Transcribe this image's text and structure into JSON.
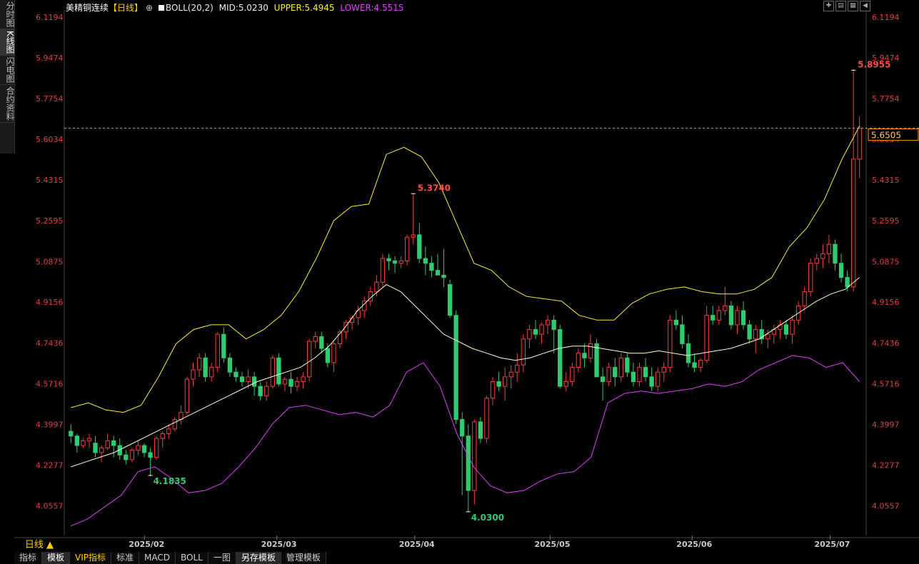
{
  "sidebar": {
    "tabs": [
      "分时图",
      "K线图",
      "闪电图",
      "合约资料"
    ]
  },
  "header": {
    "title": "美精铜连续",
    "period_tag": "【日线】",
    "ind_name": "BOLL(20,2)",
    "mid": "MID:5.0230",
    "upper": "UPPER:5.4945",
    "lower": "LOWER:4.5515"
  },
  "period_label": "日线 ▲",
  "bottom_tabs": [
    "指标",
    "模板",
    "VIP指标",
    "标准",
    "MACD",
    "BOLL",
    "一图",
    "另存模板",
    "管理模板"
  ],
  "chart_data": {
    "type": "candlestick",
    "y_ticks": [
      "6.1194",
      "5.9474",
      "5.7754",
      "5.6034",
      "5.4315",
      "5.2595",
      "5.0875",
      "4.9156",
      "4.7436",
      "4.5716",
      "4.3997",
      "4.2277",
      "4.0557"
    ],
    "x_ticks": [
      "2025/02",
      "2025/03",
      "2025/04",
      "2025/05",
      "2025/06",
      "2025/07"
    ],
    "ylim": [
      3.93,
      6.15
    ],
    "current_price": "5.6505",
    "annotations": {
      "high": "5.3740",
      "low": "4.1835",
      "low2": "4.0300",
      "max": "5.8955"
    },
    "colors": {
      "up": "#ff3b3b",
      "down": "#2ecc71",
      "mid": "#ffffcc",
      "upper": "#ffee33",
      "lower": "#e040fb",
      "price": "#ff9900"
    },
    "candles": [
      [
        4.37,
        4.4,
        4.32,
        4.35
      ],
      [
        4.35,
        4.36,
        4.28,
        4.31
      ],
      [
        4.31,
        4.34,
        4.3,
        4.33
      ],
      [
        4.33,
        4.36,
        4.3,
        4.34
      ],
      [
        4.32,
        4.35,
        4.26,
        4.28
      ],
      [
        4.28,
        4.31,
        4.24,
        4.3
      ],
      [
        4.3,
        4.36,
        4.29,
        4.33
      ],
      [
        4.33,
        4.35,
        4.26,
        4.31
      ],
      [
        4.31,
        4.34,
        4.25,
        4.27
      ],
      [
        4.27,
        4.29,
        4.23,
        4.25
      ],
      [
        4.25,
        4.3,
        4.24,
        4.29
      ],
      [
        4.29,
        4.33,
        4.27,
        4.31
      ],
      [
        4.31,
        4.32,
        4.26,
        4.28
      ],
      [
        4.28,
        4.3,
        4.18,
        4.26
      ],
      [
        4.26,
        4.35,
        4.25,
        4.34
      ],
      [
        4.34,
        4.37,
        4.3,
        4.36
      ],
      [
        4.36,
        4.4,
        4.34,
        4.38
      ],
      [
        4.38,
        4.43,
        4.37,
        4.42
      ],
      [
        4.42,
        4.48,
        4.4,
        4.45
      ],
      [
        4.45,
        4.6,
        4.44,
        4.59
      ],
      [
        4.59,
        4.66,
        4.56,
        4.63
      ],
      [
        4.63,
        4.7,
        4.6,
        4.68
      ],
      [
        4.68,
        4.7,
        4.58,
        4.6
      ],
      [
        4.6,
        4.66,
        4.58,
        4.64
      ],
      [
        4.64,
        4.79,
        4.62,
        4.78
      ],
      [
        4.78,
        4.81,
        4.66,
        4.68
      ],
      [
        4.68,
        4.7,
        4.6,
        4.62
      ],
      [
        4.62,
        4.64,
        4.58,
        4.6
      ],
      [
        4.6,
        4.62,
        4.56,
        4.58
      ],
      [
        4.58,
        4.63,
        4.55,
        4.6
      ],
      [
        4.6,
        4.62,
        4.52,
        4.56
      ],
      [
        4.56,
        4.58,
        4.5,
        4.52
      ],
      [
        4.52,
        4.58,
        4.5,
        4.56
      ],
      [
        4.56,
        4.69,
        4.55,
        4.68
      ],
      [
        4.68,
        4.7,
        4.56,
        4.57
      ],
      [
        4.57,
        4.6,
        4.54,
        4.59
      ],
      [
        4.59,
        4.62,
        4.53,
        4.56
      ],
      [
        4.56,
        4.6,
        4.54,
        4.58
      ],
      [
        4.58,
        4.62,
        4.55,
        4.6
      ],
      [
        4.6,
        4.76,
        4.58,
        4.75
      ],
      [
        4.75,
        4.79,
        4.72,
        4.77
      ],
      [
        4.77,
        4.79,
        4.7,
        4.72
      ],
      [
        4.72,
        4.74,
        4.64,
        4.66
      ],
      [
        4.66,
        4.75,
        4.62,
        4.74
      ],
      [
        4.74,
        4.8,
        4.72,
        4.79
      ],
      [
        4.79,
        4.84,
        4.76,
        4.83
      ],
      [
        4.83,
        4.86,
        4.8,
        4.85
      ],
      [
        4.85,
        4.9,
        4.82,
        4.88
      ],
      [
        4.88,
        4.94,
        4.85,
        4.92
      ],
      [
        4.92,
        4.98,
        4.9,
        4.96
      ],
      [
        4.96,
        5.03,
        4.94,
        5.0
      ],
      [
        5.0,
        5.12,
        4.98,
        5.1
      ],
      [
        5.1,
        5.12,
        5.05,
        5.09
      ],
      [
        5.09,
        5.11,
        5.04,
        5.08
      ],
      [
        5.08,
        5.11,
        5.06,
        5.09
      ],
      [
        5.09,
        5.2,
        5.07,
        5.19
      ],
      [
        5.19,
        5.37,
        5.16,
        5.2
      ],
      [
        5.2,
        5.25,
        5.08,
        5.1
      ],
      [
        5.1,
        5.15,
        5.03,
        5.08
      ],
      [
        5.08,
        5.11,
        5.02,
        5.05
      ],
      [
        5.05,
        5.12,
        5.03,
        5.03
      ],
      [
        5.03,
        5.14,
        4.98,
        5.02
      ],
      [
        4.99,
        5.01,
        4.85,
        4.86
      ],
      [
        4.86,
        4.88,
        4.4,
        4.42
      ],
      [
        4.42,
        4.45,
        4.1,
        4.35
      ],
      [
        4.35,
        4.4,
        4.03,
        4.12
      ],
      [
        4.12,
        4.42,
        4.06,
        4.41
      ],
      [
        4.41,
        4.43,
        4.32,
        4.34
      ],
      [
        4.34,
        4.52,
        4.32,
        4.51
      ],
      [
        4.51,
        4.6,
        4.48,
        4.58
      ],
      [
        4.58,
        4.62,
        4.54,
        4.56
      ],
      [
        4.56,
        4.64,
        4.5,
        4.6
      ],
      [
        4.6,
        4.65,
        4.55,
        4.62
      ],
      [
        4.62,
        4.7,
        4.58,
        4.65
      ],
      [
        4.65,
        4.78,
        4.62,
        4.76
      ],
      [
        4.76,
        4.82,
        4.72,
        4.8
      ],
      [
        4.8,
        4.84,
        4.76,
        4.78
      ],
      [
        4.78,
        4.83,
        4.74,
        4.82
      ],
      [
        4.82,
        4.86,
        4.78,
        4.84
      ],
      [
        4.84,
        4.86,
        4.7,
        4.8
      ],
      [
        4.8,
        4.82,
        4.55,
        4.56
      ],
      [
        4.56,
        4.62,
        4.54,
        4.58
      ],
      [
        4.58,
        4.66,
        4.56,
        4.64
      ],
      [
        4.64,
        4.72,
        4.62,
        4.7
      ],
      [
        4.7,
        4.74,
        4.64,
        4.68
      ],
      [
        4.68,
        4.78,
        4.66,
        4.74
      ],
      [
        4.74,
        4.76,
        4.64,
        4.6
      ],
      [
        4.6,
        4.64,
        4.5,
        4.58
      ],
      [
        4.58,
        4.66,
        4.56,
        4.64
      ],
      [
        4.64,
        4.68,
        4.56,
        4.6
      ],
      [
        4.6,
        4.7,
        4.58,
        4.68
      ],
      [
        4.68,
        4.7,
        4.6,
        4.62
      ],
      [
        4.62,
        4.66,
        4.56,
        4.58
      ],
      [
        4.58,
        4.66,
        4.56,
        4.64
      ],
      [
        4.64,
        4.68,
        4.58,
        4.6
      ],
      [
        4.6,
        4.64,
        4.54,
        4.56
      ],
      [
        4.56,
        4.64,
        4.54,
        4.62
      ],
      [
        4.62,
        4.66,
        4.58,
        4.64
      ],
      [
        4.64,
        4.86,
        4.62,
        4.84
      ],
      [
        4.84,
        4.88,
        4.8,
        4.82
      ],
      [
        4.82,
        4.86,
        4.72,
        4.74
      ],
      [
        4.74,
        4.78,
        4.64,
        4.66
      ],
      [
        4.66,
        4.7,
        4.62,
        4.64
      ],
      [
        4.64,
        4.68,
        4.62,
        4.67
      ],
      [
        4.67,
        4.9,
        4.66,
        4.86
      ],
      [
        4.86,
        4.9,
        4.82,
        4.84
      ],
      [
        4.84,
        4.9,
        4.82,
        4.88
      ],
      [
        4.88,
        4.98,
        4.86,
        4.9
      ],
      [
        4.9,
        4.92,
        4.8,
        4.82
      ],
      [
        4.82,
        4.9,
        4.78,
        4.88
      ],
      [
        4.88,
        4.92,
        4.8,
        4.82
      ],
      [
        4.82,
        4.84,
        4.74,
        4.76
      ],
      [
        4.76,
        4.82,
        4.7,
        4.8
      ],
      [
        4.8,
        4.84,
        4.74,
        4.76
      ],
      [
        4.76,
        4.8,
        4.72,
        4.78
      ],
      [
        4.78,
        4.82,
        4.74,
        4.8
      ],
      [
        4.8,
        4.84,
        4.76,
        4.82
      ],
      [
        4.82,
        4.84,
        4.76,
        4.78
      ],
      [
        4.78,
        4.86,
        4.74,
        4.84
      ],
      [
        4.84,
        4.92,
        4.82,
        4.9
      ],
      [
        4.9,
        4.98,
        4.88,
        4.96
      ],
      [
        4.96,
        5.1,
        4.94,
        5.08
      ],
      [
        5.08,
        5.12,
        5.05,
        5.1
      ],
      [
        5.1,
        5.16,
        5.06,
        5.12
      ],
      [
        5.12,
        5.2,
        5.08,
        5.16
      ],
      [
        5.16,
        5.18,
        5.05,
        5.08
      ],
      [
        5.08,
        5.12,
        5.0,
        5.02
      ],
      [
        5.02,
        5.05,
        4.96,
        4.98
      ],
      [
        4.98,
        5.9,
        4.96,
        5.52
      ],
      [
        5.52,
        5.7,
        5.44,
        5.65
      ]
    ],
    "mid": [
      4.22,
      4.24,
      4.26,
      4.28,
      4.31,
      4.34,
      4.37,
      4.4,
      4.43,
      4.46,
      4.49,
      4.52,
      4.55,
      4.58,
      4.6,
      4.62,
      4.64,
      4.68,
      4.73,
      4.8,
      4.88,
      4.94,
      4.99,
      4.96,
      4.9,
      4.84,
      4.78,
      4.75,
      4.72,
      4.7,
      4.68,
      4.67,
      4.68,
      4.7,
      4.72,
      4.73,
      4.73,
      4.72,
      4.71,
      4.7,
      4.7,
      4.71,
      4.7,
      4.69,
      4.7,
      4.71,
      4.72,
      4.74,
      4.76,
      4.8,
      4.84,
      4.88,
      4.92,
      4.95,
      4.97,
      5.02
    ],
    "upper": [
      4.47,
      4.49,
      4.46,
      4.45,
      4.48,
      4.6,
      4.74,
      4.8,
      4.82,
      4.82,
      4.76,
      4.8,
      4.86,
      4.96,
      5.1,
      5.26,
      5.32,
      5.33,
      5.54,
      5.57,
      5.53,
      5.42,
      5.25,
      5.08,
      5.05,
      4.98,
      4.94,
      4.93,
      4.92,
      4.86,
      4.84,
      4.84,
      4.91,
      4.95,
      4.97,
      4.98,
      4.96,
      4.95,
      4.95,
      4.97,
      5.02,
      5.15,
      5.23,
      5.35,
      5.52,
      5.66
    ],
    "lower": [
      3.97,
      4.0,
      4.05,
      4.1,
      4.2,
      4.22,
      4.17,
      4.11,
      4.12,
      4.15,
      4.22,
      4.3,
      4.4,
      4.47,
      4.48,
      4.46,
      4.44,
      4.45,
      4.43,
      4.48,
      4.62,
      4.66,
      4.56,
      4.36,
      4.22,
      4.14,
      4.11,
      4.12,
      4.16,
      4.19,
      4.2,
      4.26,
      4.49,
      4.53,
      4.54,
      4.53,
      4.54,
      4.55,
      4.57,
      4.56,
      4.58,
      4.63,
      4.66,
      4.69,
      4.68,
      4.64,
      4.66,
      4.58
    ]
  }
}
